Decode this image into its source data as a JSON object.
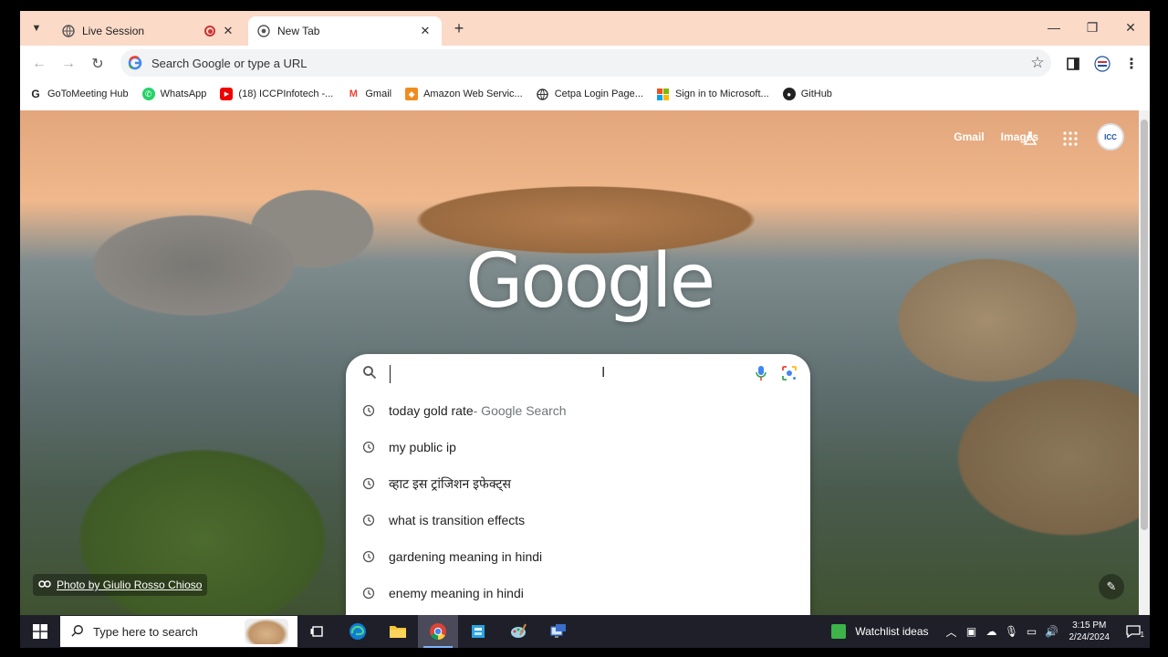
{
  "tabs": [
    {
      "title": "Live Session",
      "active": false
    },
    {
      "title": "New Tab",
      "active": true
    }
  ],
  "toolbar": {
    "omnibox_text": "Search Google or type a URL"
  },
  "bookmarks": [
    {
      "label": "GoToMeeting Hub",
      "icon": "gotomeeting-icon"
    },
    {
      "label": "WhatsApp",
      "icon": "whatsapp-icon"
    },
    {
      "label": "(18) ICCPInfotech -...",
      "icon": "youtube-icon"
    },
    {
      "label": "Gmail",
      "icon": "gmail-icon"
    },
    {
      "label": "Amazon Web Servic...",
      "icon": "aws-icon"
    },
    {
      "label": "Cetpa Login Page...",
      "icon": "globe-icon"
    },
    {
      "label": "Sign in to Microsoft...",
      "icon": "microsoft-icon"
    },
    {
      "label": "GitHub",
      "icon": "github-icon"
    }
  ],
  "ntp": {
    "gmail": "Gmail",
    "images": "Images",
    "logo": "Google",
    "avatar": "ICC",
    "photo_credit": "Photo by Giulio Rosso Chioso"
  },
  "suggestions": [
    {
      "text": "today gold rate",
      "suffix": " - Google Search"
    },
    {
      "text": "my public ip",
      "suffix": ""
    },
    {
      "text": "व्हाट इस ट्रांजिशन इफेक्ट्स",
      "suffix": ""
    },
    {
      "text": "what is transition effects",
      "suffix": ""
    },
    {
      "text": "gardening meaning in hindi",
      "suffix": ""
    },
    {
      "text": "enemy meaning in hindi",
      "suffix": ""
    }
  ],
  "taskbar": {
    "search_placeholder": "Type here to search",
    "watchlist": "Watchlist ideas",
    "time": "3:15 PM",
    "date": "2/24/2024",
    "notifications": "1"
  }
}
